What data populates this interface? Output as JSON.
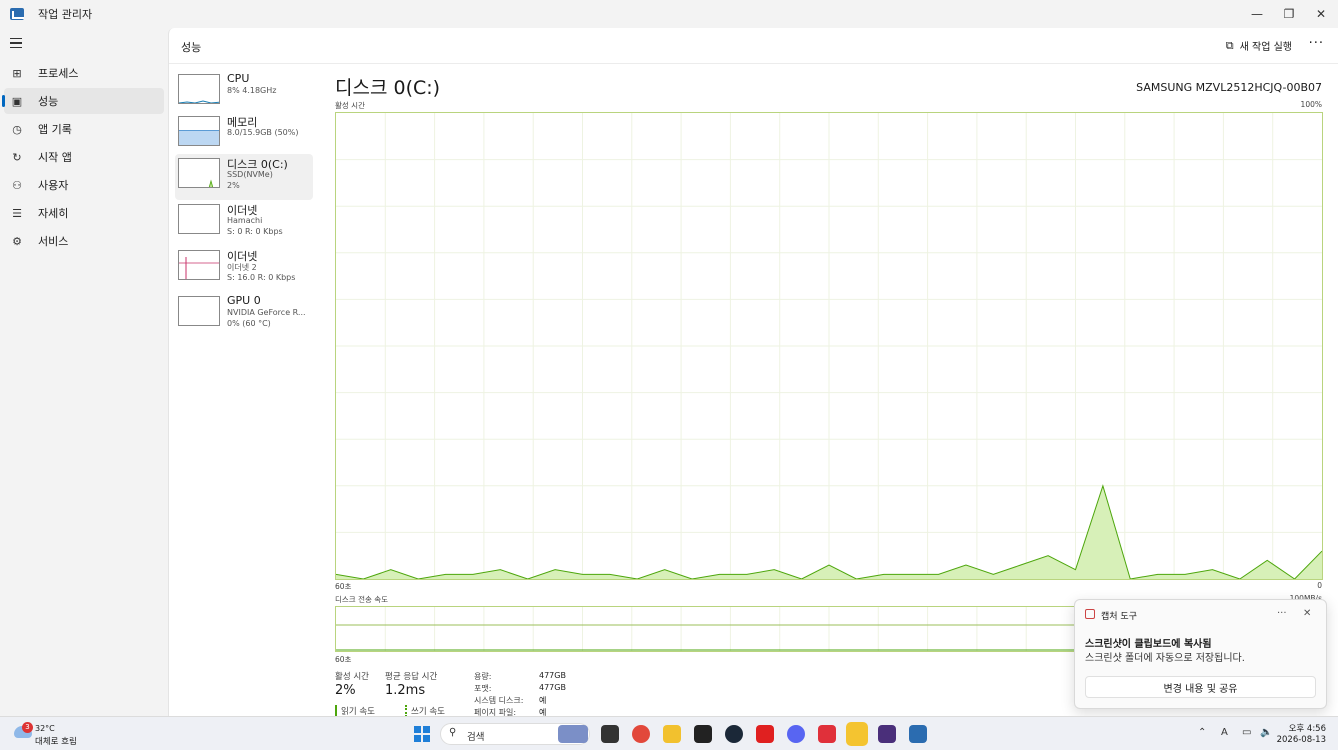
{
  "window": {
    "title": "작업 관리자",
    "minimize_glyph": "—",
    "restore_glyph": "❐",
    "close_glyph": "✕"
  },
  "nav": {
    "items": [
      {
        "label": "프로세스",
        "icon": "processes-icon",
        "glyph": "⊞"
      },
      {
        "label": "성능",
        "icon": "performance-icon",
        "glyph": "▣"
      },
      {
        "label": "앱 기록",
        "icon": "app-history-icon",
        "glyph": "◷"
      },
      {
        "label": "시작 앱",
        "icon": "startup-icon",
        "glyph": "↻"
      },
      {
        "label": "사용자",
        "icon": "users-icon",
        "glyph": "⚇"
      },
      {
        "label": "자세히",
        "icon": "details-icon",
        "glyph": "☰"
      },
      {
        "label": "서비스",
        "icon": "services-icon",
        "glyph": "⚙"
      }
    ]
  },
  "header": {
    "title": "성능",
    "new_task": "새 작업 실행",
    "more": "···"
  },
  "devices": [
    {
      "name": "CPU",
      "sub1": "8% 4.18GHz",
      "sub2": ""
    },
    {
      "name": "메모리",
      "sub1": "8.0/15.9GB (50%)",
      "sub2": ""
    },
    {
      "name": "디스크 0(C:)",
      "sub1": "SSD(NVMe)",
      "sub2": "2%"
    },
    {
      "name": "이더넷",
      "sub1": "Hamachi",
      "sub2": "S: 0 R: 0 Kbps"
    },
    {
      "name": "이더넷",
      "sub1": "이더넷 2",
      "sub2": "S: 16.0 R: 0 Kbps"
    },
    {
      "name": "GPU 0",
      "sub1": "NVIDIA GeForce R...",
      "sub2": "0% (60 °C)"
    }
  ],
  "detail": {
    "title": "디스크 0(C:)",
    "model": "SAMSUNG MZVL2512HCJQ-00B07",
    "graph1_label": "활성 시간",
    "graph1_max": "100%",
    "graph1_min": "0",
    "graph1_time": "60초",
    "graph2_label": "디스크 전송 속도",
    "graph2_max": "100MB/s",
    "graph2_time": "60초"
  },
  "stats": {
    "active_time_label": "활성 시간",
    "active_time_value": "2%",
    "avg_response_label": "평균 응답 시간",
    "avg_response_value": "1.2ms",
    "read_label": "읽기 속도",
    "write_label": "쓰기 속도",
    "capacity_label": "용량:",
    "capacity_value": "477GB",
    "formatted_label": "포맷:",
    "formatted_value": "477GB",
    "system_disk_label": "시스템 디스크:",
    "system_disk_value": "예",
    "page_file_label": "페이지 파일:",
    "page_file_value": "예"
  },
  "chart_data": [
    {
      "type": "area",
      "title": "활성 시간",
      "ylabel": "",
      "ylim": [
        0,
        100
      ],
      "x": [
        60,
        58,
        56,
        54,
        52,
        50,
        48,
        46,
        44,
        42,
        40,
        38,
        36,
        34,
        32,
        30,
        28,
        26,
        24,
        22,
        20,
        18,
        16,
        14,
        12,
        10,
        8,
        6,
        4,
        2,
        0
      ],
      "series": [
        {
          "values": [
            1,
            0,
            2,
            0,
            1,
            1,
            2,
            0,
            2,
            1,
            1,
            0,
            2,
            0,
            1,
            1,
            2,
            0,
            3,
            0,
            1,
            1,
            1,
            3,
            1,
            3,
            5,
            2,
            20,
            0,
            1,
            1,
            2,
            0,
            4,
            0,
            6
          ]
        }
      ]
    },
    {
      "type": "line",
      "title": "디스크 전송 속도",
      "ylim": [
        0,
        100
      ],
      "series": [
        {
          "name": "읽기 속도",
          "values": [
            0,
            0,
            0,
            0,
            0,
            0,
            0,
            0,
            0,
            0,
            0,
            0,
            0,
            0,
            0,
            0,
            0,
            0,
            0,
            0,
            0,
            0,
            0,
            0,
            0,
            0,
            0,
            0,
            0,
            0,
            0
          ]
        },
        {
          "name": "쓰기 속도",
          "values": [
            0,
            0,
            0,
            0,
            0,
            0,
            0,
            0,
            0,
            0,
            0,
            0,
            0,
            0,
            0,
            0,
            0,
            0,
            0,
            0,
            0,
            0,
            0,
            0,
            0,
            0,
            0,
            0,
            2,
            0,
            1
          ]
        }
      ]
    }
  ],
  "toast": {
    "app": "캡처 도구",
    "more": "···",
    "close": "✕",
    "title": "스크린샷이 클립보드에 복사됨",
    "body": "스크린샷 폴더에 자동으로 저장됩니다.",
    "button": "변경 내용 및 공유"
  },
  "taskbar": {
    "weather_temp": "32°C",
    "weather_desc": "대체로 흐림",
    "weather_badge": "3",
    "search_placeholder": "검색",
    "time": "오후 4:56",
    "date": "2026-08-13",
    "tray_ime": "A"
  },
  "colors": {
    "disk_line": "#4da60c",
    "disk_fill": "#d7f0b8",
    "grid": "#eef3e2",
    "accent": "#0067c0"
  }
}
